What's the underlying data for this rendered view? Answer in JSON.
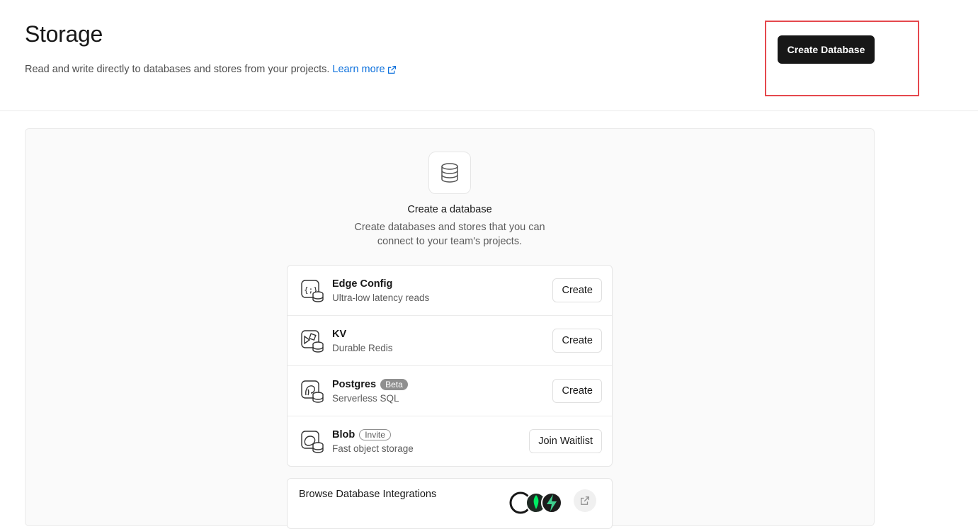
{
  "header": {
    "title": "Storage",
    "subtitle": "Read and write directly to databases and stores from your projects.",
    "learn_more": "Learn more",
    "create_button": "Create Database"
  },
  "empty_state": {
    "title": "Create a database",
    "description": "Create databases and stores that you can connect to your team's projects."
  },
  "databases": [
    {
      "name": "Edge Config",
      "subtitle": "Ultra-low latency reads",
      "action": "Create",
      "icon": "edge-config-icon"
    },
    {
      "name": "KV",
      "subtitle": "Durable Redis",
      "action": "Create",
      "icon": "kv-icon"
    },
    {
      "name": "Postgres",
      "badge": "Beta",
      "subtitle": "Serverless SQL",
      "action": "Create",
      "icon": "postgres-icon"
    },
    {
      "name": "Blob",
      "badge": "Invite",
      "subtitle": "Fast object storage",
      "action": "Join Waitlist",
      "icon": "blob-icon"
    }
  ],
  "integrations": {
    "title": "Browse Database Integrations"
  },
  "colors": {
    "primary_button": "#171717",
    "link": "#0a6fdc",
    "highlight": "#e5484d"
  }
}
